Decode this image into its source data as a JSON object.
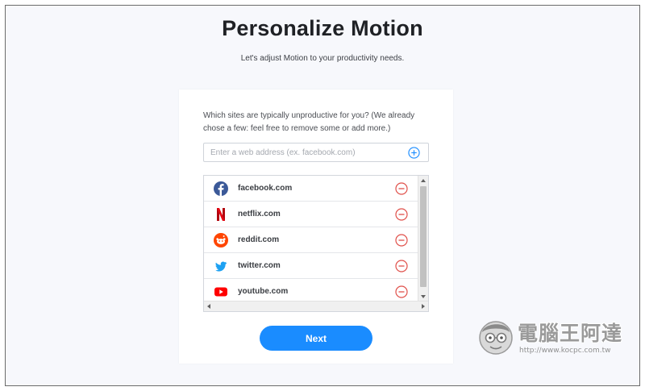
{
  "header": {
    "title": "Personalize Motion",
    "subtitle": "Let's adjust Motion to your productivity needs."
  },
  "form": {
    "question": "Which sites are typically unproductive for you? (We already chose a few: feel free to remove some or add more.)",
    "input": {
      "value": "",
      "placeholder": "Enter a web address (ex. facebook.com)",
      "add_icon": "plus-circle-icon"
    },
    "sites": [
      {
        "name": "facebook.com",
        "icon": "facebook-icon",
        "color": "#3b5998"
      },
      {
        "name": "netflix.com",
        "icon": "netflix-icon",
        "color": "#e50914"
      },
      {
        "name": "reddit.com",
        "icon": "reddit-icon",
        "color": "#ff4500"
      },
      {
        "name": "twitter.com",
        "icon": "twitter-icon",
        "color": "#1da1f2"
      },
      {
        "name": "youtube.com",
        "icon": "youtube-icon",
        "color": "#ff0000"
      }
    ],
    "remove_icon": "minus-circle-icon",
    "next_label": "Next"
  },
  "colors": {
    "accent": "#1a8cff",
    "remove": "#e0504a",
    "add": "#1a8cff"
  },
  "watermark": {
    "title": "電腦王阿達",
    "url": "http://www.kocpc.com.tw"
  }
}
